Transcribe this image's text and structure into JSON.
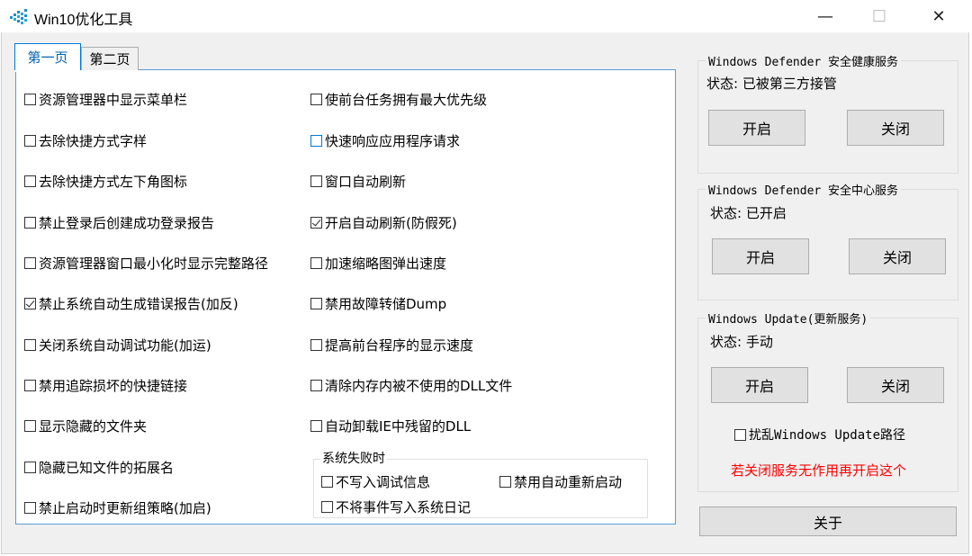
{
  "window": {
    "title": "Win10优化工具",
    "minimize_glyph": "—",
    "maximize_glyph": "☐",
    "close_glyph": "✕"
  },
  "tabs": [
    {
      "label": "第一页",
      "selected": true
    },
    {
      "label": "第二页",
      "selected": false
    }
  ],
  "left_options": [
    {
      "label": "资源管理器中显示菜单栏",
      "checked": false
    },
    {
      "label": "去除快捷方式字样",
      "checked": false
    },
    {
      "label": "去除快捷方式左下角图标",
      "checked": false
    },
    {
      "label": "禁止登录后创建成功登录报告",
      "checked": false
    },
    {
      "label": "资源管理器窗口最小化时显示完整路径",
      "checked": false
    },
    {
      "label": "禁止系统自动生成错误报告(加反)",
      "checked": true
    },
    {
      "label": "关闭系统自动调试功能(加运)",
      "checked": false
    },
    {
      "label": "禁用追踪损坏的快捷链接",
      "checked": false
    },
    {
      "label": "显示隐藏的文件夹",
      "checked": false
    },
    {
      "label": "隐藏已知文件的拓展名",
      "checked": false
    },
    {
      "label": "禁止启动时更新组策略(加启)",
      "checked": false
    }
  ],
  "right_options": [
    {
      "label": "使前台任务拥有最大优先级",
      "checked": false
    },
    {
      "label": "快速响应应用程序请求",
      "checked": false
    },
    {
      "label": "窗口自动刷新",
      "checked": false
    },
    {
      "label": "开启自动刷新(防假死)",
      "checked": true
    },
    {
      "label": "加速缩略图弹出速度",
      "checked": false
    },
    {
      "label": "禁用故障转储Dump",
      "checked": false
    },
    {
      "label": "提高前台程序的显示速度",
      "checked": false
    },
    {
      "label": "清除内存内被不使用的DLL文件",
      "checked": false
    },
    {
      "label": "自动卸载IE中残留的DLL",
      "checked": false
    }
  ],
  "system_failure": {
    "title": "系统失败时",
    "options": [
      {
        "label": "不写入调试信息",
        "checked": false
      },
      {
        "label": "禁用自动重新启动",
        "checked": false
      },
      {
        "label": "不将事件写入系统日记",
        "checked": false
      }
    ]
  },
  "services": [
    {
      "title": "Windows Defender 安全健康服务",
      "status": "状态: 已被第三方接管",
      "start_label": "开启",
      "stop_label": "关闭"
    },
    {
      "title": "Windows Defender 安全中心服务",
      "status": "状态: 已开启",
      "start_label": "开启",
      "stop_label": "关闭"
    },
    {
      "title": "Windows Update(更新服务)",
      "status": "状态: 手动",
      "start_label": "开启",
      "stop_label": "关闭"
    }
  ],
  "update_path_option": {
    "label": "扰乱Windows Update路径",
    "checked": false
  },
  "warning_text": "若关闭服务无作用再开启这个",
  "warning_color": "#ff0000",
  "about_label": "关于"
}
